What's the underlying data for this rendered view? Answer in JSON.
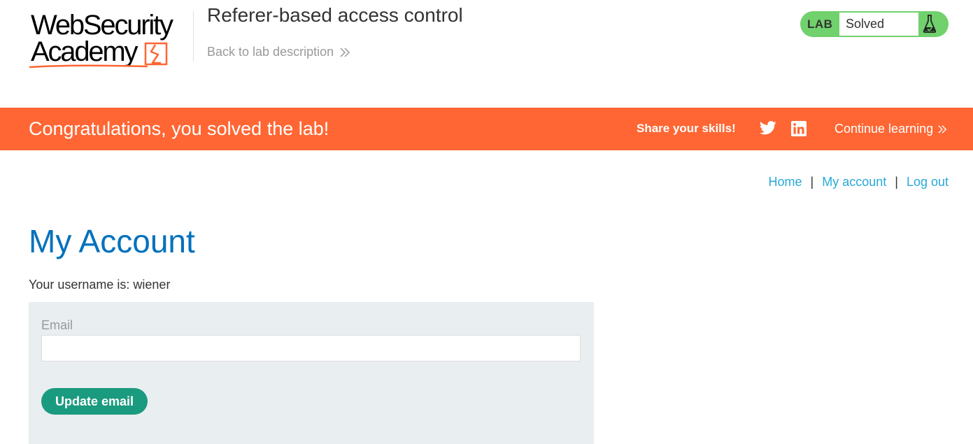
{
  "header": {
    "logo_line1": "WebSecurity",
    "logo_line2": "Academy",
    "lab_title": "Referer-based access control",
    "back_link": "Back to lab description",
    "status": {
      "label": "LAB",
      "text": "Solved",
      "icon": "flask-icon"
    }
  },
  "banner": {
    "message": "Congratulations, you solved the lab!",
    "share_label": "Share your skills!",
    "continue_link": "Continue learning"
  },
  "nav": {
    "home": "Home",
    "my_account": "My account",
    "log_out": "Log out",
    "separator": "|"
  },
  "main": {
    "title": "My Account",
    "username_text": "Your username is: wiener",
    "form": {
      "email_label": "Email",
      "email_value": "",
      "button_label": "Update email"
    }
  },
  "colors": {
    "banner": "#ff6633",
    "status_green": "#70d16d",
    "link_blue": "#29a9d8",
    "title_blue": "#0071bc",
    "button_teal": "#1a9a7f",
    "panel_grey": "#e9eef0"
  }
}
